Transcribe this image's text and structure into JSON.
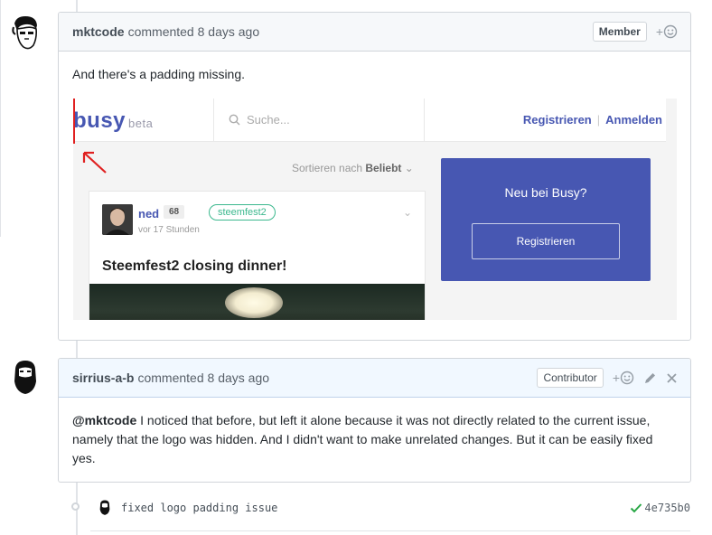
{
  "comment1": {
    "author": "mktcode",
    "action": "commented",
    "time": "8 days ago",
    "badge": "Member",
    "body": "And there's a padding missing."
  },
  "screenshot": {
    "logo": "busy",
    "logo_suffix": "beta",
    "search_placeholder": "Suche...",
    "nav_register": "Registrieren",
    "nav_login": "Anmelden",
    "sort_label": "Sortieren nach",
    "sort_value": "Beliebt",
    "post": {
      "author": "ned",
      "reputation": "68",
      "tag": "steemfest2",
      "time": "vor 17 Stunden",
      "title": "Steemfest2 closing dinner!"
    },
    "signup": {
      "title": "Neu bei Busy?",
      "button": "Registrieren"
    }
  },
  "comment2": {
    "author": "sirrius-a-b",
    "action": "commented",
    "time": "8 days ago",
    "badge": "Contributor",
    "mention": "@mktcode",
    "body": " I noticed that before, but left it alone because it was not directly related to the current issue, namely that the logo was hidden. And I didn't want to make unrelated changes. But it can be easily fixed yes."
  },
  "commit": {
    "message": "fixed logo padding issue",
    "sha": "4e735b0"
  },
  "colors": {
    "busy_blue": "#4757b2",
    "tag_green": "#3cb88e",
    "annotation_red": "#e02020",
    "check_green": "#28a745"
  }
}
